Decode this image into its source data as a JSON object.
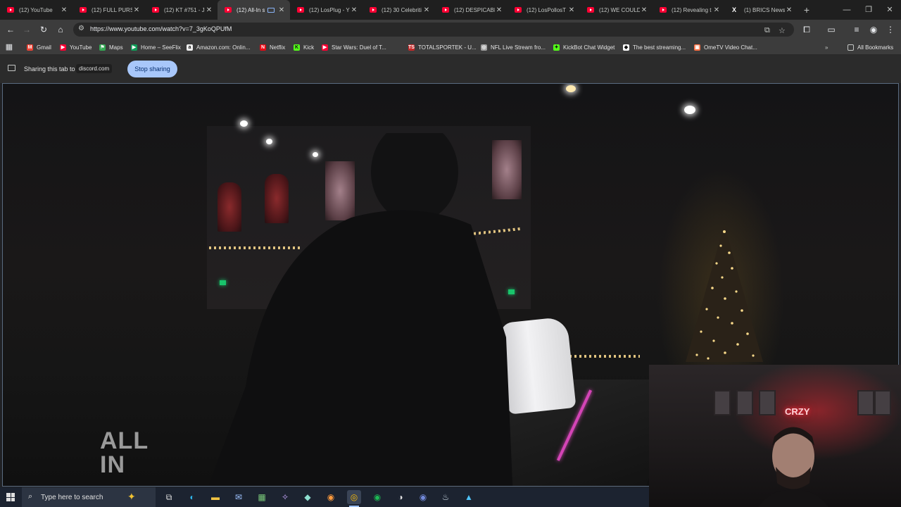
{
  "tabs": [
    {
      "title": "(12) YouTube",
      "icon": "youtube-icon"
    },
    {
      "title": "(12) FULL PURSU",
      "icon": "youtube-icon"
    },
    {
      "title": "(12) KT #751 - J",
      "icon": "youtube-icon"
    },
    {
      "title": "(12) All-In s",
      "icon": "youtube-icon",
      "active": true
    },
    {
      "title": "(12) LosPlug - Y",
      "icon": "youtube-icon"
    },
    {
      "title": "(12) 30 Celebriti",
      "icon": "youtube-icon"
    },
    {
      "title": "(12) DESPICABL",
      "icon": "youtube-icon"
    },
    {
      "title": "(12) LosPollosT",
      "icon": "youtube-icon"
    },
    {
      "title": "(12) WE COULD",
      "icon": "youtube-icon"
    },
    {
      "title": "(12) Revealing t",
      "icon": "youtube-icon"
    },
    {
      "title": "(1) BRICS News",
      "icon": "x-icon"
    }
  ],
  "browser": {
    "url": "https://www.youtube.com/watch?v=7_3gKoQPUfM",
    "new_tab": "+",
    "minimize": "—",
    "restore": "❐",
    "close": "✕"
  },
  "bookmarks": [
    {
      "label": "Gmail",
      "color": "#ea4335",
      "glyph": "M"
    },
    {
      "label": "YouTube",
      "color": "#ff0033",
      "glyph": "▶"
    },
    {
      "label": "Maps",
      "color": "#34a853",
      "glyph": "⚑"
    },
    {
      "label": "Home – SeeFlix",
      "color": "#0f9d58",
      "glyph": "▶"
    },
    {
      "label": "Amazon.com: Onlin...",
      "color": "#f0f0f0",
      "glyph": "a"
    },
    {
      "label": "Netflix",
      "color": "#e50914",
      "glyph": "N"
    },
    {
      "label": "Kick",
      "color": "#53fc18",
      "glyph": "K"
    },
    {
      "label": "Star Wars: Duel of T...",
      "color": "#ff0033",
      "glyph": "▶"
    },
    {
      "label": "TOTALSPORTEK - U...",
      "color": "#c62828",
      "glyph": "TS"
    },
    {
      "label": "NFL Live Stream fro...",
      "color": "#9e9e9e",
      "glyph": "◎"
    },
    {
      "label": "KickBot Chat Widget",
      "color": "#53fc18",
      "glyph": "✦"
    },
    {
      "label": "The best streaming...",
      "color": "#ffffff",
      "glyph": "◆"
    },
    {
      "label": "OmeTV Video Chat...",
      "color": "#ff7043",
      "glyph": "▣"
    }
  ],
  "all_bookmarks": "All Bookmarks",
  "sharing": {
    "text": "Sharing this tab to",
    "domain": "discord.com",
    "stop_label": "Stop sharing"
  },
  "video": {
    "logo_line1": "ALL",
    "logo_line2": "IN"
  },
  "webcam": {
    "neon_text": "CRZY"
  },
  "taskbar": {
    "search_placeholder": "Type here to search",
    "apps": [
      "task-view",
      "edge",
      "file-explorer",
      "mail",
      "calculator",
      "app-5",
      "app-6",
      "firefox",
      "chrome",
      "spotify",
      "app-10",
      "app-11",
      "steam",
      "app-13"
    ]
  }
}
